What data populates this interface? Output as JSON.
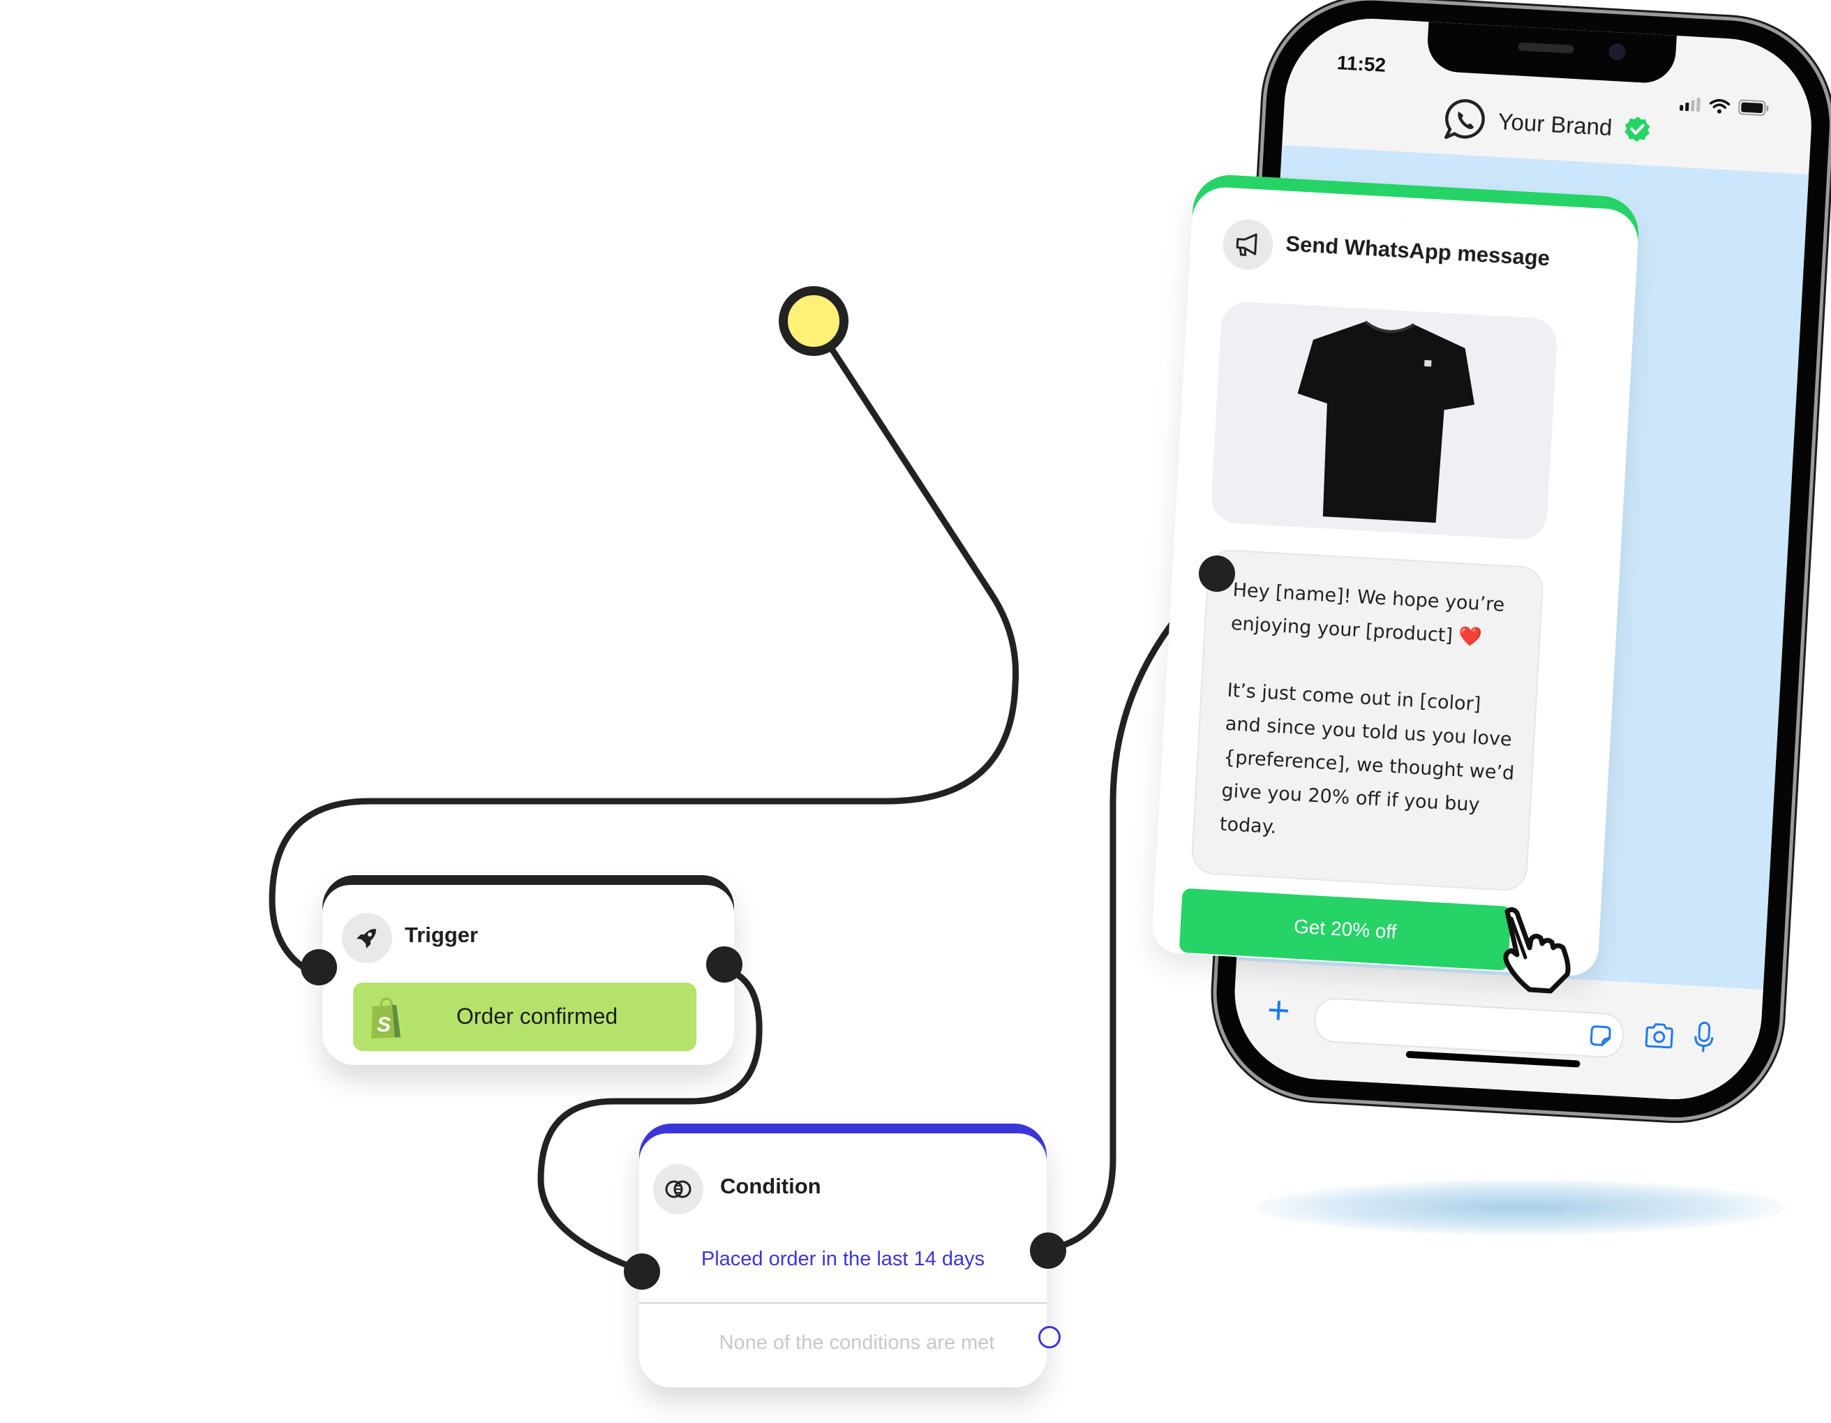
{
  "flow": {
    "start_node": {
      "color": "#fff176"
    },
    "trigger": {
      "title": "Trigger",
      "icon": "rocket-icon",
      "event_label": "Order confirmed",
      "event_source_icon": "shopify-bag-icon",
      "colors": {
        "accent": "#222222",
        "pill": "#b5e26a"
      }
    },
    "condition": {
      "title": "Condition",
      "icon": "venn-circles-icon",
      "branches": [
        {
          "label": "Placed order in the last 14 days",
          "state": "connected"
        },
        {
          "label": "None of the conditions are met",
          "state": "empty"
        }
      ],
      "colors": {
        "accent": "#3b35d9",
        "muted": "#c8c8c8"
      }
    },
    "action": {
      "title": "Send WhatsApp message",
      "icon": "megaphone-icon",
      "product_image": "black-tshirt",
      "message_paragraphs": [
        "Hey [name]! We hope you’re enjoying your [product] ❤️",
        "It’s just come out in [color] and since you told us you love {preference], we thought we’d give you 20% off if you buy today."
      ],
      "cta_label": "Get 20% off",
      "colors": {
        "accent": "#25d366"
      }
    }
  },
  "phone": {
    "status_time": "11:52",
    "status_icons": [
      "signal-icon",
      "wifi-icon",
      "battery-icon"
    ],
    "contact_name": "Your Brand",
    "verified": true,
    "chat_background": "#cce7fb",
    "composer_icons": [
      "plus-icon",
      "sticker-icon",
      "camera-icon",
      "microphone-icon"
    ],
    "accent": "#1f7aea"
  }
}
